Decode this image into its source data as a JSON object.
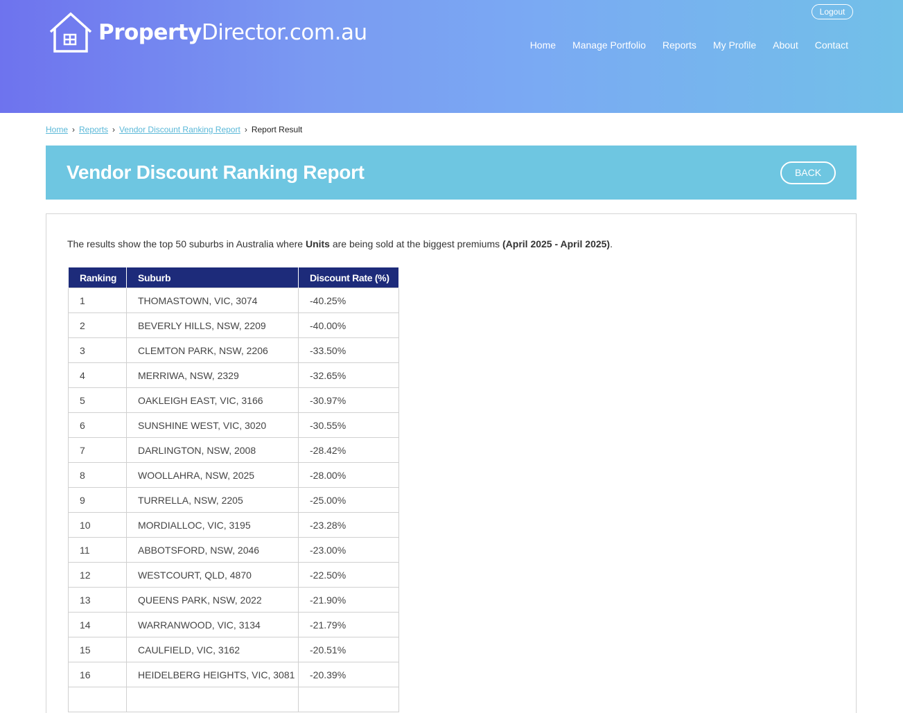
{
  "header": {
    "logo_bold": "Property",
    "logo_light": "Director.com.au",
    "logout_label": "Logout",
    "nav": [
      "Home",
      "Manage Portfolio",
      "Reports",
      "My Profile",
      "About",
      "Contact"
    ]
  },
  "breadcrumb": {
    "home": "Home",
    "reports": "Reports",
    "report": "Vendor Discount Ranking Report",
    "current": "Report Result"
  },
  "banner": {
    "title": "Vendor Discount Ranking Report",
    "back_label": "BACK"
  },
  "intro": {
    "text1": "The results show the top 50 suburbs in Australia where ",
    "bold1": "Units",
    "text2": " are being sold at the biggest premiums ",
    "bold2": "(April 2025 - April 2025)",
    "text3": "."
  },
  "table": {
    "headers": [
      "Ranking",
      "Suburb",
      "Discount Rate (%)"
    ],
    "rows": [
      [
        "1",
        "THOMASTOWN, VIC, 3074",
        "-40.25%"
      ],
      [
        "2",
        "BEVERLY HILLS, NSW, 2209",
        "-40.00%"
      ],
      [
        "3",
        "CLEMTON PARK, NSW, 2206",
        "-33.50%"
      ],
      [
        "4",
        "MERRIWA, NSW, 2329",
        "-32.65%"
      ],
      [
        "5",
        "OAKLEIGH EAST, VIC, 3166",
        "-30.97%"
      ],
      [
        "6",
        "SUNSHINE WEST, VIC, 3020",
        "-30.55%"
      ],
      [
        "7",
        "DARLINGTON, NSW, 2008",
        "-28.42%"
      ],
      [
        "8",
        "WOOLLAHRA, NSW, 2025",
        "-28.00%"
      ],
      [
        "9",
        "TURRELLA, NSW, 2205",
        "-25.00%"
      ],
      [
        "10",
        "MORDIALLOC, VIC, 3195",
        "-23.28%"
      ],
      [
        "11",
        "ABBOTSFORD, NSW, 2046",
        "-23.00%"
      ],
      [
        "12",
        "WESTCOURT, QLD, 4870",
        "-22.50%"
      ],
      [
        "13",
        "QUEENS PARK, NSW, 2022",
        "-21.90%"
      ],
      [
        "14",
        "WARRANWOOD, VIC, 3134",
        "-21.79%"
      ],
      [
        "15",
        "CAULFIELD, VIC, 3162",
        "-20.51%"
      ],
      [
        "16",
        "HEIDELBERG HEIGHTS, VIC, 3081",
        "-20.39%"
      ],
      [
        "",
        "",
        ""
      ]
    ]
  },
  "colors": {
    "banner": "#6ec6e1",
    "table_header": "#1d2b7a",
    "link": "#5ab8d8"
  }
}
